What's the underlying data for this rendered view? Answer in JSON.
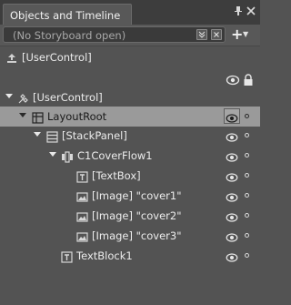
{
  "panel": {
    "title": "Objects and Timeline",
    "storyboard_text": "(No Storyboard open)"
  },
  "scope": {
    "label": "[UserControl]"
  },
  "tree": [
    {
      "label": "[UserControl]",
      "icon": "usercontrol-icon",
      "selected": false
    },
    {
      "label": "LayoutRoot",
      "icon": "grid-icon",
      "selected": true
    },
    {
      "label": "[StackPanel]",
      "icon": "stackpanel-icon",
      "selected": false
    },
    {
      "label": "C1CoverFlow1",
      "icon": "coverflow-icon",
      "selected": false
    },
    {
      "label": "[TextBox]",
      "icon": "textbox-icon",
      "selected": false
    },
    {
      "label": "[Image] \"cover1\"",
      "icon": "image-icon",
      "selected": false
    },
    {
      "label": "[Image] \"cover2\"",
      "icon": "image-icon",
      "selected": false
    },
    {
      "label": "[Image] \"cover3\"",
      "icon": "image-icon",
      "selected": false
    },
    {
      "label": "TextBlock1",
      "icon": "textblock-icon",
      "selected": false
    }
  ]
}
